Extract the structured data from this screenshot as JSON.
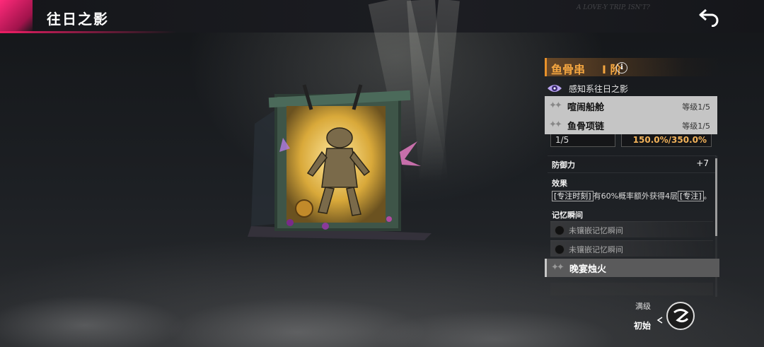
{
  "header": {
    "title": "往日之影",
    "back_icon": "back-arrow-icon",
    "watermark": "A LOVE-Y TRIP, ISN'T?"
  },
  "item": {
    "name": "鱼骨串",
    "tier": "I 阶",
    "info_icon": "info-icon",
    "type_icon": "perception-eye-icon",
    "type_text": "感知系往日之影"
  },
  "dropdown": {
    "items": [
      {
        "name": "喧闹船舱",
        "level": "等级1/5"
      },
      {
        "name": "鱼骨项链",
        "level": "等级1/5"
      }
    ]
  },
  "stats": {
    "level_box": "1/5",
    "percent_box": "150.0%/350.0%",
    "defense_label": "防御力",
    "defense_value": "+7"
  },
  "effect": {
    "label": "效果",
    "tag1": "[专注时刻]",
    "text_mid": "有60%概率额外获得4层",
    "tag2": "[专注]",
    "text_end": "。"
  },
  "memory": {
    "label": "记忆瞬间",
    "slots": [
      "未镶嵌记忆瞬间",
      "未镶嵌记忆瞬间"
    ]
  },
  "next_item": {
    "name": "晚宴烛火"
  },
  "level_switch": {
    "max_label": "满级",
    "init_label": "初始"
  },
  "colors": {
    "accent_orange": "#f4a640",
    "magenta": "#e91e63",
    "dropdown_bg": "#c5c5c5"
  }
}
